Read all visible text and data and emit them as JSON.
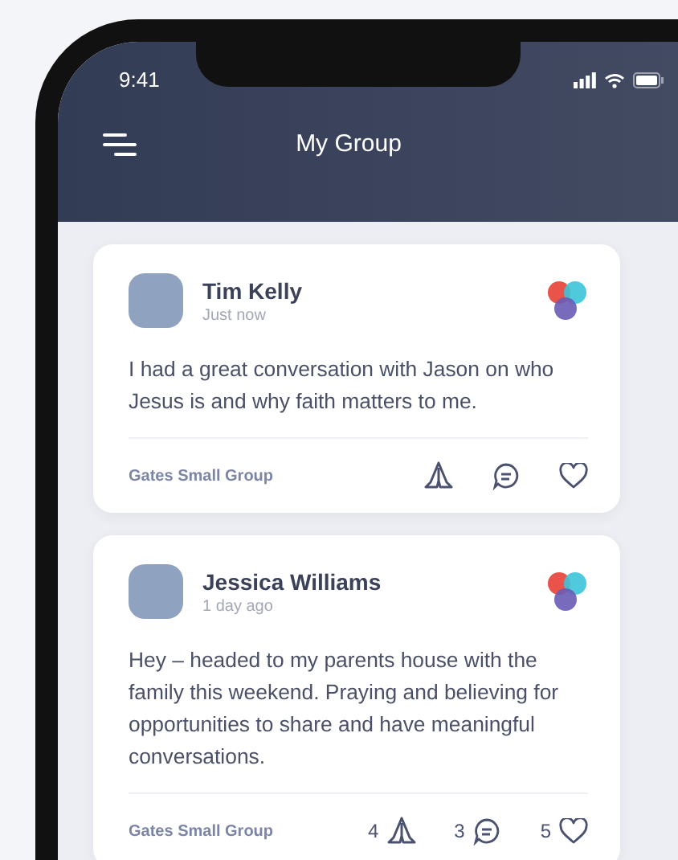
{
  "status_bar": {
    "time": "9:41"
  },
  "header": {
    "title": "My Group"
  },
  "posts": [
    {
      "author": "Tim Kelly",
      "time": "Just now",
      "text": "I had a great conversation with Jason on who Jesus is and why faith matters to me.",
      "group": "Gates Small Group",
      "actions": [
        {
          "kind": "pray"
        },
        {
          "kind": "comment"
        },
        {
          "kind": "like"
        }
      ]
    },
    {
      "author": "Jessica Williams",
      "time": "1 day ago",
      "text": "Hey – headed to my parents house with the family this weekend. Praying and believing for opportunities to share and have meaningful conversations.",
      "group": "Gates Small Group",
      "actions": [
        {
          "kind": "pray",
          "count": "4"
        },
        {
          "kind": "comment",
          "count": "3"
        },
        {
          "kind": "like",
          "count": "5"
        }
      ]
    }
  ]
}
